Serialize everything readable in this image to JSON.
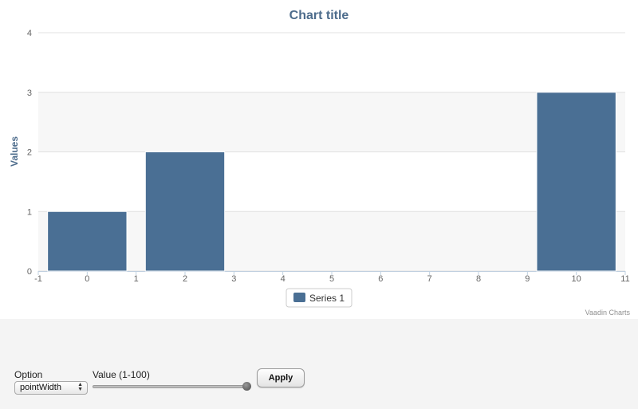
{
  "chart_data": {
    "type": "bar",
    "title": "Chart title",
    "xlabel": "",
    "ylabel": "Values",
    "x": [
      0,
      2,
      10
    ],
    "series": [
      {
        "name": "Series 1",
        "values": [
          1,
          2,
          3
        ],
        "color": "#4a6f94"
      }
    ],
    "xlim": [
      -1,
      11
    ],
    "ylim": [
      0,
      4
    ],
    "xticks": [
      -1,
      0,
      1,
      2,
      3,
      4,
      5,
      6,
      7,
      8,
      9,
      10,
      11
    ],
    "yticks": [
      0,
      1,
      2,
      3,
      4
    ],
    "grid": true,
    "alternate_band_color": "#f7f7f7",
    "legend": "bottom-center",
    "credits": "Vaadin Charts"
  },
  "controls": {
    "option_label": "Option",
    "option_value": "pointWidth",
    "value_label": "Value (1-100)",
    "slider_value": 100,
    "apply_label": "Apply"
  }
}
